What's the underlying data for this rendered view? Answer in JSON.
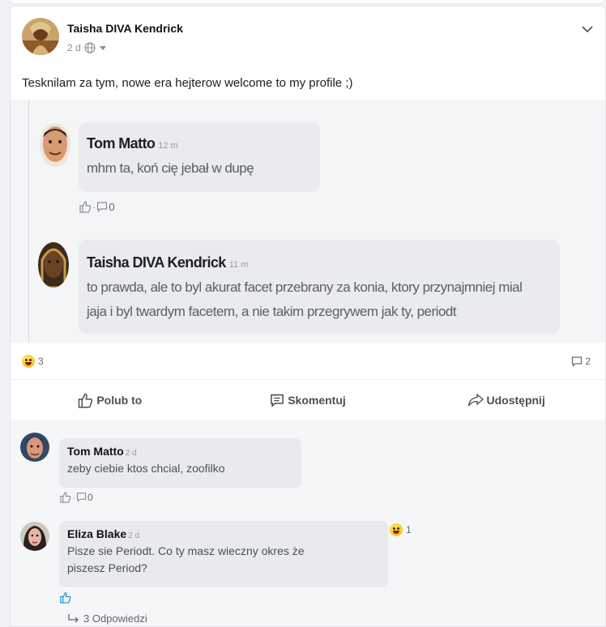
{
  "post": {
    "author": "Taisha DIVA Kendrick",
    "time": "2 d",
    "text": "Tesknilam za tym, nowe era hejterow welcome to my profile ;)"
  },
  "screenshot": {
    "comments": [
      {
        "name": "Tom Matto",
        "time": "12 m",
        "lines": [
          "mhm ta, koń cię jebał w dupę"
        ],
        "replies": "0"
      },
      {
        "name": "Taisha DIVA Kendrick",
        "time": "11 m",
        "lines": [
          "to prawda, ale to byl akurat facet przebrany za konia, ktory przynajmniej mial",
          "jaja i byl twardym facetem, a nie takim przegrywem jak ty, periodt"
        ]
      }
    ]
  },
  "stats": {
    "reaction_count": "3",
    "comment_count": "2"
  },
  "actions": {
    "like": "Polub to",
    "comment": "Skomentuj",
    "share": "Udostępnij"
  },
  "comments": [
    {
      "name": "Tom Matto",
      "time": "2 d",
      "text": "zeby ciebie ktos chcial, zoofilko",
      "reply_count": "0"
    },
    {
      "name": "Eliza Blake",
      "time": "2 d",
      "text_lines": [
        "Pisze sie Periodt. Co ty masz wieczny okres że",
        "piszesz Period?"
      ],
      "reaction_count": "1",
      "replies_label": "3 Odpowiedzi"
    }
  ],
  "colors": {
    "accent": "#1b8fd1",
    "bubble": "#e9eaed",
    "emoji": "#f7b500"
  }
}
